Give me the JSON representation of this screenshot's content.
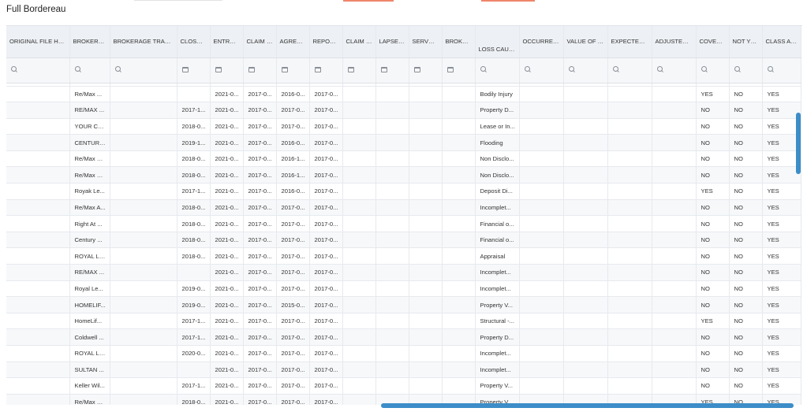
{
  "page": {
    "title": "Full Bordereau"
  },
  "columns": [
    {
      "key": "orig_handler",
      "label": "ORIGINAL FILE HANDLER",
      "sort": true,
      "filter": "search"
    },
    {
      "key": "brokerage",
      "label": "BROKERAGE",
      "sort": true,
      "filter": "search"
    },
    {
      "key": "brokerage_txn",
      "label": "BROKERAGE TRANSACTION",
      "sort": false,
      "filter": "search"
    },
    {
      "key": "close_date",
      "label": "CLOSE DATE",
      "sort": false,
      "filter": "calendar"
    },
    {
      "key": "entry_date",
      "label": "ENTRY DATE",
      "sort": false,
      "filter": "calendar"
    },
    {
      "key": "claim_date",
      "label": "CLAIM DATE",
      "sort": false,
      "filter": "calendar"
    },
    {
      "key": "agreement",
      "label": "AGREEMENT",
      "sort": false,
      "filter": "calendar"
    },
    {
      "key": "report_date",
      "label": "REPORT DAT",
      "sort": false,
      "filter": "calendar"
    },
    {
      "key": "claim_paid",
      "label": "CLAIM PAID D",
      "sort": false,
      "filter": "calendar"
    },
    {
      "key": "lapse_date",
      "label": "LAPSE DATE",
      "sort": false,
      "filter": "calendar"
    },
    {
      "key": "served_date",
      "label": "SERVED DAT",
      "sort": false,
      "filter": "calendar"
    },
    {
      "key": "brokerage2",
      "label": "BROKERAGE",
      "sort": false,
      "filter": "calendar"
    },
    {
      "key": "loss_cause",
      "label": "LOSS CAUSE",
      "sort": true,
      "filter": "search"
    },
    {
      "key": "occurrence",
      "label": "OCCURRENCE NO",
      "sort": false,
      "filter": "search"
    },
    {
      "key": "value_txn",
      "label": "VALUE OF TRANSA",
      "sort": false,
      "filter": "search"
    },
    {
      "key": "expected_payout",
      "label": "EXPECTED PAYOU",
      "sort": false,
      "filter": "search"
    },
    {
      "key": "adjusted_gross",
      "label": "ADJUSTED GROSS",
      "sort": false,
      "filter": "search"
    },
    {
      "key": "coverage",
      "label": "COVERAGE IS",
      "sort": false,
      "filter": "search"
    },
    {
      "key": "not_yet",
      "label": "NOT YET REF",
      "sort": false,
      "filter": "search"
    },
    {
      "key": "class_action",
      "label": "CLASS ACTIO",
      "sort": false,
      "filter": "search"
    }
  ],
  "rows": [
    [
      "",
      "Re/Max ...",
      "",
      "",
      "2021-0...",
      "2017-0...",
      "2016-0...",
      "2017-0...",
      "",
      "",
      "",
      "",
      "Bodily Injury",
      "",
      "",
      "",
      "",
      "YES",
      "NO",
      "YES"
    ],
    [
      "",
      "RE/MAX ...",
      "",
      "2017-1...",
      "2021-0...",
      "2017-0...",
      "2017-0...",
      "2017-0...",
      "",
      "",
      "",
      "",
      "Property D...",
      "",
      "",
      "",
      "",
      "NO",
      "NO",
      "YES"
    ],
    [
      "",
      "YOUR CH...",
      "",
      "2018-0...",
      "2021-0...",
      "2017-0...",
      "2017-0...",
      "2017-0...",
      "",
      "",
      "",
      "",
      "Lease or In...",
      "",
      "",
      "",
      "",
      "NO",
      "NO",
      "YES"
    ],
    [
      "",
      "CENTURY...",
      "",
      "2019-1...",
      "2021-0...",
      "2017-0...",
      "2016-0...",
      "2017-0...",
      "",
      "",
      "",
      "",
      "Flooding",
      "",
      "",
      "",
      "",
      "NO",
      "NO",
      "YES"
    ],
    [
      "",
      "Re/Max H...",
      "",
      "2018-0...",
      "2021-0...",
      "2017-0...",
      "2016-1...",
      "2017-0...",
      "",
      "",
      "",
      "",
      "Non Disclo...",
      "",
      "",
      "",
      "",
      "NO",
      "NO",
      "YES"
    ],
    [
      "",
      "Re/Max H...",
      "",
      "2018-0...",
      "2021-0...",
      "2017-0...",
      "2016-1...",
      "2017-0...",
      "",
      "",
      "",
      "",
      "Non Disclo...",
      "",
      "",
      "",
      "",
      "NO",
      "NO",
      "YES"
    ],
    [
      "",
      "Royak Le...",
      "",
      "2017-1...",
      "2021-0...",
      "2017-0...",
      "2016-0...",
      "2017-0...",
      "",
      "",
      "",
      "",
      "Deposit Di...",
      "",
      "",
      "",
      "",
      "YES",
      "NO",
      "YES"
    ],
    [
      "",
      "Re/Max A...",
      "",
      "2018-0...",
      "2021-0...",
      "2017-0...",
      "2017-0...",
      "2017-0...",
      "",
      "",
      "",
      "",
      "Incomplet...",
      "",
      "",
      "",
      "",
      "NO",
      "NO",
      "YES"
    ],
    [
      "",
      "Right At ...",
      "",
      "2018-0...",
      "2021-0...",
      "2017-0...",
      "2017-0...",
      "2017-0...",
      "",
      "",
      "",
      "",
      "Financial o...",
      "",
      "",
      "",
      "",
      "NO",
      "NO",
      "YES"
    ],
    [
      "",
      "Century ...",
      "",
      "2018-0...",
      "2021-0...",
      "2017-0...",
      "2017-0...",
      "2017-0...",
      "",
      "",
      "",
      "",
      "Financial o...",
      "",
      "",
      "",
      "",
      "NO",
      "NO",
      "YES"
    ],
    [
      "",
      "ROYAL LE...",
      "",
      "2018-0...",
      "2021-0...",
      "2017-0...",
      "2017-0...",
      "2017-0...",
      "",
      "",
      "",
      "",
      "Appraisal",
      "",
      "",
      "",
      "",
      "NO",
      "NO",
      "YES"
    ],
    [
      "",
      "RE/MAX ...",
      "",
      "",
      "2021-0...",
      "2017-0...",
      "2017-0...",
      "2017-0...",
      "",
      "",
      "",
      "",
      "Incomplet...",
      "",
      "",
      "",
      "",
      "NO",
      "NO",
      "YES"
    ],
    [
      "",
      "Royal Le...",
      "",
      "2019-0...",
      "2021-0...",
      "2017-0...",
      "2017-0...",
      "2017-0...",
      "",
      "",
      "",
      "",
      "Incomplet...",
      "",
      "",
      "",
      "",
      "NO",
      "NO",
      "YES"
    ],
    [
      "",
      "HOMELIF...",
      "",
      "2019-0...",
      "2021-0...",
      "2017-0...",
      "2015-0...",
      "2017-0...",
      "",
      "",
      "",
      "",
      "Property V...",
      "",
      "",
      "",
      "",
      "NO",
      "NO",
      "YES"
    ],
    [
      "",
      "HomeLif...",
      "",
      "2017-1...",
      "2021-0...",
      "2017-0...",
      "2017-0...",
      "2017-0...",
      "",
      "",
      "",
      "",
      "Structural -...",
      "",
      "",
      "",
      "",
      "YES",
      "NO",
      "YES"
    ],
    [
      "",
      "Coldwell ...",
      "",
      "2017-1...",
      "2021-0...",
      "2017-0...",
      "2017-0...",
      "2017-0...",
      "",
      "",
      "",
      "",
      "Property D...",
      "",
      "",
      "",
      "",
      "NO",
      "NO",
      "YES"
    ],
    [
      "",
      "ROYAL LE...",
      "",
      "2020-0...",
      "2021-0...",
      "2017-0...",
      "2017-0...",
      "2017-0...",
      "",
      "",
      "",
      "",
      "Incomplet...",
      "",
      "",
      "",
      "",
      "NO",
      "NO",
      "YES"
    ],
    [
      "",
      "SULTAN ...",
      "",
      "",
      "2021-0...",
      "2017-0...",
      "2017-0...",
      "2017-0...",
      "",
      "",
      "",
      "",
      "Incomplet...",
      "",
      "",
      "",
      "",
      "NO",
      "NO",
      "YES"
    ],
    [
      "",
      "Keller Wil...",
      "",
      "2017-1...",
      "2021-0...",
      "2017-0...",
      "2017-0...",
      "2017-0...",
      "",
      "",
      "",
      "",
      "Property V...",
      "",
      "",
      "",
      "",
      "NO",
      "NO",
      "YES"
    ],
    [
      "",
      "Re/Max H...",
      "",
      "2018-0...",
      "2021-0...",
      "2017-0...",
      "2017-0...",
      "2017-0...",
      "",
      "",
      "",
      "",
      "Property V...",
      "",
      "",
      "",
      "",
      "YES",
      "NO",
      "YES"
    ]
  ]
}
